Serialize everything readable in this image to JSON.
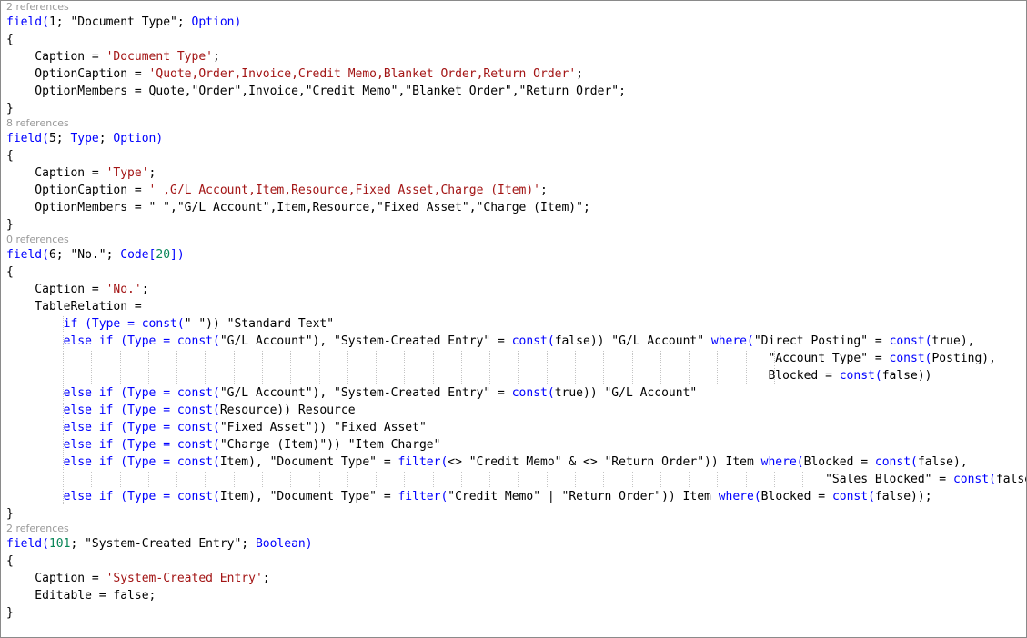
{
  "editor": {
    "colors": {
      "keyword": "#0000ff",
      "string": "#a31515",
      "number": "#098658",
      "text": "#000000",
      "codelens": "#999999",
      "indent_guide": "#c4c4c4"
    },
    "lines": [
      {
        "kind": "ref",
        "text": "2 references"
      },
      {
        "kind": "code",
        "tokens": [
          {
            "t": "kw",
            "v": "field("
          },
          {
            "t": "txt",
            "v": "1; \"Document Type\"; "
          },
          {
            "t": "kw",
            "v": "Option)"
          }
        ]
      },
      {
        "kind": "code",
        "tokens": [
          {
            "t": "txt",
            "v": "{"
          }
        ]
      },
      {
        "kind": "code",
        "tokens": [
          {
            "t": "txt",
            "v": "    Caption = "
          },
          {
            "t": "str",
            "v": "'Document Type'"
          },
          {
            "t": "txt",
            "v": ";"
          }
        ]
      },
      {
        "kind": "code",
        "tokens": [
          {
            "t": "txt",
            "v": "    OptionCaption = "
          },
          {
            "t": "str",
            "v": "'Quote,Order,Invoice,Credit Memo,Blanket Order,Return Order'"
          },
          {
            "t": "txt",
            "v": ";"
          }
        ]
      },
      {
        "kind": "code",
        "tokens": [
          {
            "t": "txt",
            "v": "    OptionMembers = Quote,\"Order\",Invoice,\"Credit Memo\",\"Blanket Order\",\"Return Order\";"
          }
        ]
      },
      {
        "kind": "code",
        "tokens": [
          {
            "t": "txt",
            "v": "}"
          }
        ]
      },
      {
        "kind": "ref",
        "text": "8 references"
      },
      {
        "kind": "code",
        "tokens": [
          {
            "t": "kw",
            "v": "field("
          },
          {
            "t": "txt",
            "v": "5; "
          },
          {
            "t": "kw",
            "v": "Type"
          },
          {
            "t": "txt",
            "v": "; "
          },
          {
            "t": "kw",
            "v": "Option)"
          }
        ]
      },
      {
        "kind": "code",
        "tokens": [
          {
            "t": "txt",
            "v": "{"
          }
        ]
      },
      {
        "kind": "code",
        "tokens": [
          {
            "t": "txt",
            "v": "    Caption = "
          },
          {
            "t": "str",
            "v": "'Type'"
          },
          {
            "t": "txt",
            "v": ";"
          }
        ]
      },
      {
        "kind": "code",
        "tokens": [
          {
            "t": "txt",
            "v": "    OptionCaption = "
          },
          {
            "t": "str",
            "v": "' ,G/L Account,Item,Resource,Fixed Asset,Charge (Item)'"
          },
          {
            "t": "txt",
            "v": ";"
          }
        ]
      },
      {
        "kind": "code",
        "tokens": [
          {
            "t": "txt",
            "v": "    OptionMembers = \" \",\"G/L Account\",Item,Resource,\"Fixed Asset\",\"Charge (Item)\";"
          }
        ]
      },
      {
        "kind": "code",
        "tokens": [
          {
            "t": "txt",
            "v": "}"
          }
        ]
      },
      {
        "kind": "ref",
        "text": "0 references"
      },
      {
        "kind": "code",
        "tokens": [
          {
            "t": "kw",
            "v": "field("
          },
          {
            "t": "txt",
            "v": "6; \"No.\"; "
          },
          {
            "t": "kw",
            "v": "Code["
          },
          {
            "t": "num",
            "v": "20"
          },
          {
            "t": "kw",
            "v": "])"
          }
        ]
      },
      {
        "kind": "code",
        "tokens": [
          {
            "t": "txt",
            "v": "{"
          }
        ]
      },
      {
        "kind": "code",
        "tokens": [
          {
            "t": "txt",
            "v": "    Caption = "
          },
          {
            "t": "str",
            "v": "'No.'"
          },
          {
            "t": "txt",
            "v": ";"
          }
        ]
      },
      {
        "kind": "code",
        "tokens": [
          {
            "t": "txt",
            "v": "    TableRelation ="
          }
        ]
      },
      {
        "kind": "code",
        "guides": 1,
        "tokens": [
          {
            "t": "txt",
            "v": "        "
          },
          {
            "t": "kw",
            "v": "if (Type = const("
          },
          {
            "t": "txt",
            "v": "\" \")) \"Standard Text\""
          }
        ]
      },
      {
        "kind": "code",
        "guides": 1,
        "tokens": [
          {
            "t": "txt",
            "v": "        "
          },
          {
            "t": "kw",
            "v": "else if (Type = const("
          },
          {
            "t": "txt",
            "v": "\"G/L Account\"), \"System-Created Entry\" = "
          },
          {
            "t": "kw",
            "v": "const("
          },
          {
            "t": "txt",
            "v": "false)) \"G/L Account\" "
          },
          {
            "t": "kw",
            "v": "where("
          },
          {
            "t": "txt",
            "v": "\"Direct Posting\" = "
          },
          {
            "t": "kw",
            "v": "const("
          },
          {
            "t": "txt",
            "v": "true),"
          }
        ]
      },
      {
        "kind": "code",
        "guides": 26,
        "tokens": [
          {
            "t": "txt",
            "v": "                                                                                                           \"Account Type\" = "
          },
          {
            "t": "kw",
            "v": "const("
          },
          {
            "t": "txt",
            "v": "Posting),"
          }
        ]
      },
      {
        "kind": "code",
        "guides": 26,
        "tokens": [
          {
            "t": "txt",
            "v": "                                                                                                           Blocked = "
          },
          {
            "t": "kw",
            "v": "const("
          },
          {
            "t": "txt",
            "v": "false))"
          }
        ]
      },
      {
        "kind": "code",
        "guides": 1,
        "tokens": [
          {
            "t": "txt",
            "v": "        "
          },
          {
            "t": "kw",
            "v": "else if (Type = const("
          },
          {
            "t": "txt",
            "v": "\"G/L Account\"), \"System-Created Entry\" = "
          },
          {
            "t": "kw",
            "v": "const("
          },
          {
            "t": "txt",
            "v": "true)) \"G/L Account\""
          }
        ]
      },
      {
        "kind": "code",
        "guides": 1,
        "tokens": [
          {
            "t": "txt",
            "v": "        "
          },
          {
            "t": "kw",
            "v": "else if (Type = const("
          },
          {
            "t": "txt",
            "v": "Resource)) Resource"
          }
        ]
      },
      {
        "kind": "code",
        "guides": 1,
        "tokens": [
          {
            "t": "txt",
            "v": "        "
          },
          {
            "t": "kw",
            "v": "else if (Type = const("
          },
          {
            "t": "txt",
            "v": "\"Fixed Asset\")) \"Fixed Asset\""
          }
        ]
      },
      {
        "kind": "code",
        "guides": 1,
        "tokens": [
          {
            "t": "txt",
            "v": "        "
          },
          {
            "t": "kw",
            "v": "else if (Type = const("
          },
          {
            "t": "txt",
            "v": "\"Charge (Item)\")) \"Item Charge\""
          }
        ]
      },
      {
        "kind": "code",
        "guides": 1,
        "tokens": [
          {
            "t": "txt",
            "v": "        "
          },
          {
            "t": "kw",
            "v": "else if (Type = const("
          },
          {
            "t": "txt",
            "v": "Item), \"Document Type\" = "
          },
          {
            "t": "kw",
            "v": "filter("
          },
          {
            "t": "txt",
            "v": "<> \"Credit Memo\" & <> \"Return Order\")) Item "
          },
          {
            "t": "kw",
            "v": "where("
          },
          {
            "t": "txt",
            "v": "Blocked = "
          },
          {
            "t": "kw",
            "v": "const("
          },
          {
            "t": "txt",
            "v": "false),"
          }
        ]
      },
      {
        "kind": "code",
        "guides": 27,
        "tokens": [
          {
            "t": "txt",
            "v": "                                                                                                                   \"Sales Blocked\" = "
          },
          {
            "t": "kw",
            "v": "const("
          },
          {
            "t": "txt",
            "v": "false))"
          }
        ]
      },
      {
        "kind": "code",
        "guides": 1,
        "tokens": [
          {
            "t": "txt",
            "v": "        "
          },
          {
            "t": "kw",
            "v": "else if (Type = const("
          },
          {
            "t": "txt",
            "v": "Item), \"Document Type\" = "
          },
          {
            "t": "kw",
            "v": "filter("
          },
          {
            "t": "txt",
            "v": "\"Credit Memo\" | \"Return Order\")) Item "
          },
          {
            "t": "kw",
            "v": "where("
          },
          {
            "t": "txt",
            "v": "Blocked = "
          },
          {
            "t": "kw",
            "v": "const("
          },
          {
            "t": "txt",
            "v": "false));"
          }
        ]
      },
      {
        "kind": "code",
        "tokens": [
          {
            "t": "txt",
            "v": "}"
          }
        ]
      },
      {
        "kind": "ref",
        "text": "2 references"
      },
      {
        "kind": "code",
        "tokens": [
          {
            "t": "kw",
            "v": "field("
          },
          {
            "t": "num",
            "v": "101"
          },
          {
            "t": "txt",
            "v": "; \"System-Created Entry\"; "
          },
          {
            "t": "kw",
            "v": "Boolean)"
          }
        ]
      },
      {
        "kind": "code",
        "tokens": [
          {
            "t": "txt",
            "v": "{"
          }
        ]
      },
      {
        "kind": "code",
        "tokens": [
          {
            "t": "txt",
            "v": "    Caption = "
          },
          {
            "t": "str",
            "v": "'System-Created Entry'"
          },
          {
            "t": "txt",
            "v": ";"
          }
        ]
      },
      {
        "kind": "code",
        "tokens": [
          {
            "t": "txt",
            "v": "    Editable = false;"
          }
        ]
      },
      {
        "kind": "code",
        "tokens": [
          {
            "t": "txt",
            "v": "}"
          }
        ]
      }
    ]
  }
}
